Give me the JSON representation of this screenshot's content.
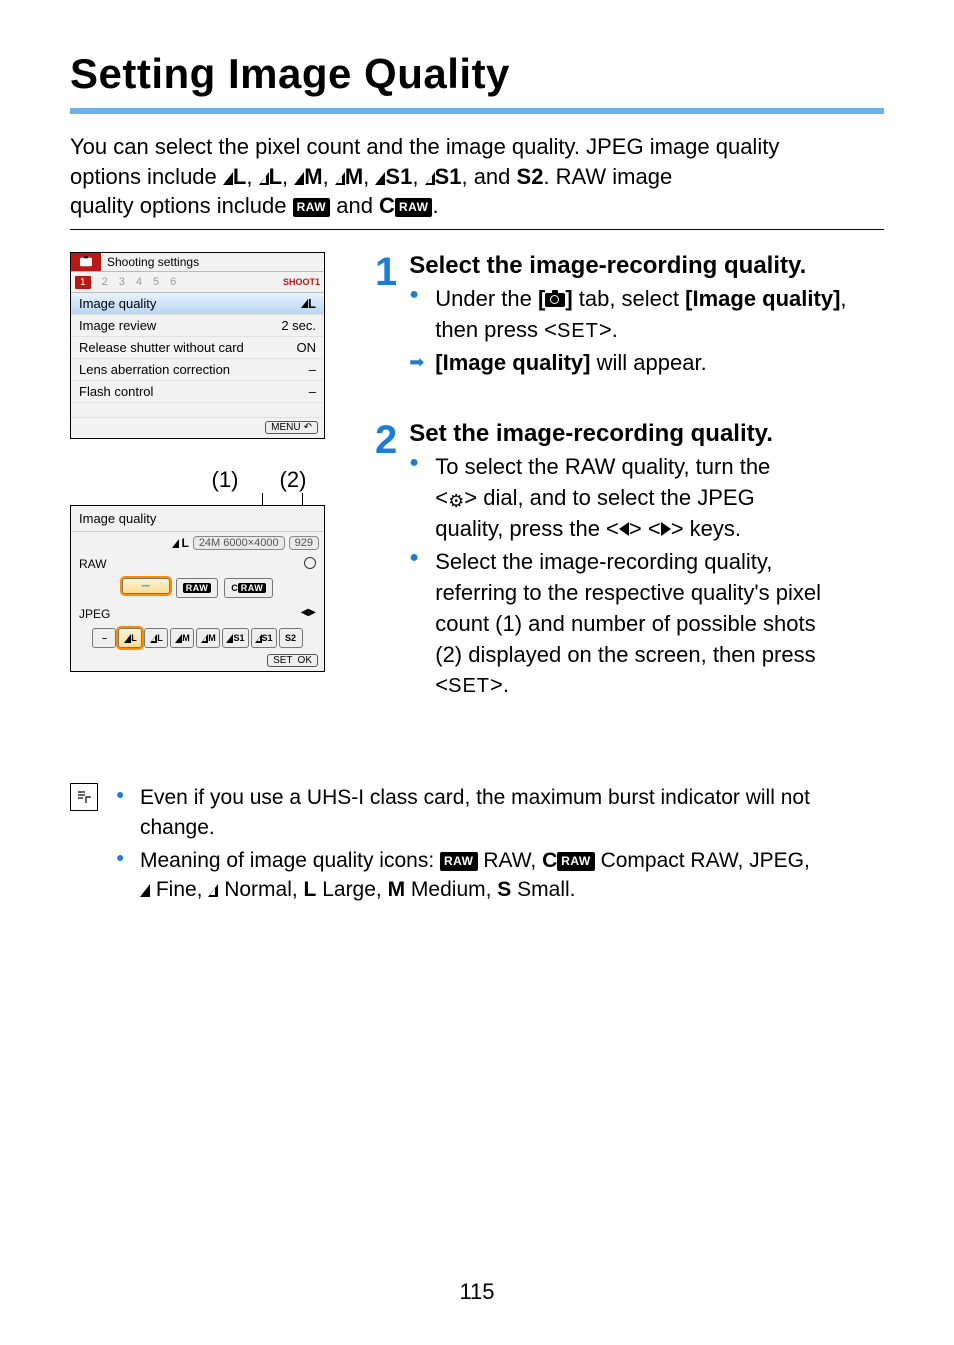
{
  "page_number": "115",
  "title": "Setting Image Quality",
  "intro": {
    "line1": "You can select the pixel count and the image quality. JPEG image quality",
    "line2_pre": "options include ",
    "opts": [
      "L",
      "L",
      "M",
      "M",
      "S1",
      "S1",
      "S2"
    ],
    "line2_post": ". RAW image",
    "line3_pre": "quality options include ",
    "raw1": "RAW",
    "and": " and ",
    "raw2": "CRAW",
    "line3_post": "."
  },
  "shot1": {
    "tab_title": "Shooting settings",
    "tabs": [
      "1",
      "2",
      "3",
      "4",
      "5",
      "6"
    ],
    "shoot_label": "SHOOT1",
    "rows": [
      {
        "label": "Image quality",
        "value": "L",
        "icon": "fine"
      },
      {
        "label": "Image review",
        "value": "2 sec."
      },
      {
        "label": "Release shutter without card",
        "value": "ON"
      },
      {
        "label": "Lens aberration correction",
        "value": "–"
      },
      {
        "label": "Flash control",
        "value": "–"
      }
    ],
    "menu_label": "MENU"
  },
  "callout1": "(1)",
  "callout2": "(2)",
  "shot2": {
    "title": "Image quality",
    "status_pre_icon": "fine",
    "status_pre_size": "L",
    "status_px": "24M 6000×4000",
    "status_shots": "929",
    "raw_label": "RAW",
    "raw_opts": [
      "–",
      "RAW",
      "CRAW"
    ],
    "jpeg_label": "JPEG",
    "jpeg_opts": [
      "–",
      "L",
      "L",
      "M",
      "M",
      "S1",
      "S1",
      "S2"
    ],
    "set": "SET",
    "ok": "OK"
  },
  "step1": {
    "num": "1",
    "title": "Select the image-recording quality.",
    "b1_pre": "Under the ",
    "b1_tab": "[",
    "b1_tab2": "]",
    "b1_mid": " tab, select ",
    "b1_bold": "[Image quality]",
    "b1_post": ", then press <",
    "b1_set": "SET",
    "b1_end": ">.",
    "b2_bold": "[Image quality]",
    "b2_post": " will appear."
  },
  "step2": {
    "num": "2",
    "title": "Set the image-recording quality.",
    "b1_l1": "To select the RAW quality, turn the",
    "b1_l2_pre": "<",
    "b1_l2_post": "> dial, and to select the JPEG",
    "b1_l3_pre": "quality, press the <",
    "b1_l3_mid": "> <",
    "b1_l3_post": "> keys.",
    "b2_l1": "Select the image-recording quality,",
    "b2_l2": "referring to the respective quality's pixel",
    "b2_l3": "count (1) and number of possible shots",
    "b2_l4": "(2) displayed on the screen, then press",
    "b2_l5_pre": "<",
    "b2_l5_set": "SET",
    "b2_l5_post": ">."
  },
  "notes": {
    "n1_l1": "Even if you use a UHS-I class card, the maximum burst indicator will not",
    "n1_l2": "change.",
    "n2_l1_pre": "Meaning of image quality icons: ",
    "n2_raw": "RAW",
    "n2_rawtxt": " RAW, ",
    "n2_craw": "CRAW",
    "n2_crawtxt": " Compact RAW, JPEG,",
    "n2_l2_fine": " Fine, ",
    "n2_l2_norm": " Normal, ",
    "n2_l2_L": "L",
    "n2_l2_Ltxt": " Large, ",
    "n2_l2_M": "M",
    "n2_l2_Mtxt": " Medium, ",
    "n2_l2_S": "S",
    "n2_l2_Stxt": " Small."
  }
}
